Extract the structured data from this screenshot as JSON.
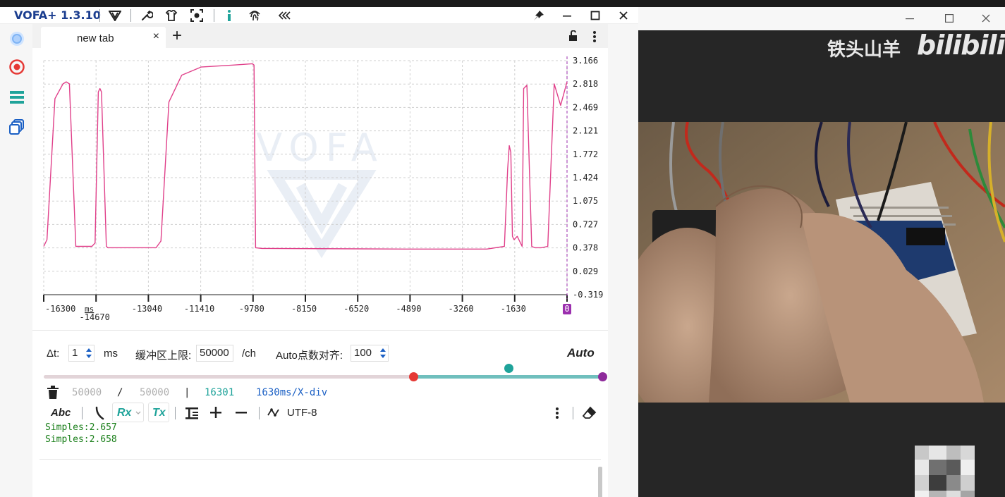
{
  "app": {
    "title": "VOFA+ 1.3.10",
    "colors": {
      "accent": "#1a3d8f",
      "teal": "#1fa39a",
      "trace": "#e0408a",
      "cursor": "#9b2fae",
      "red": "#e53935"
    }
  },
  "titlebar": {
    "icons": [
      "vofa-logo-icon",
      "wrench-icon",
      "shirt-icon",
      "focus-icon",
      "info-icon",
      "fingerprint-icon",
      "collapse-icon"
    ],
    "window_controls": [
      "pin-icon",
      "minimize-icon",
      "maximize-icon",
      "close-icon"
    ]
  },
  "sidebar": {
    "items": [
      "connect-icon",
      "record-icon",
      "menu-icon",
      "layers-icon"
    ]
  },
  "tabs": {
    "items": [
      {
        "label": "new tab",
        "close": "×"
      }
    ],
    "add": "+",
    "lock_icon": "lock-icon",
    "more_icon": "more-vert-icon"
  },
  "plot": {
    "y_ticks": [
      "3.166",
      "2.818",
      "2.469",
      "2.121",
      "1.772",
      "1.424",
      "1.075",
      "0.727",
      "0.378",
      "0.029",
      "-0.319"
    ],
    "x_ticks": [
      "-16300",
      "-14670",
      "-13040",
      "-11410",
      "-9780",
      "-8150",
      "-6520",
      "-4890",
      "-3260",
      "-1630",
      "0"
    ],
    "x_unit": "ms",
    "watermark": "VOFA"
  },
  "chart_data": {
    "type": "line",
    "x": [
      -16300,
      -16200,
      -15950,
      -15700,
      -15600,
      -15500,
      -15300,
      -14800,
      -14700,
      -14600,
      -14550,
      -14500,
      -14350,
      -14300,
      -12800,
      -12650,
      -12400,
      -12000,
      -11400,
      -10400,
      -9800,
      -9750,
      -9700,
      -9500,
      -5000,
      -2500,
      -1950,
      -1850,
      -1800,
      -1750,
      -1700,
      -1650,
      -1550,
      -1400,
      -1350,
      -1250,
      -1100,
      -1000,
      -800,
      -600,
      -400,
      -200,
      0
    ],
    "y": [
      0.4,
      0.5,
      2.6,
      2.82,
      2.85,
      2.82,
      0.4,
      0.4,
      0.45,
      2.7,
      2.75,
      2.7,
      0.4,
      0.38,
      0.38,
      0.48,
      2.55,
      2.95,
      3.07,
      3.1,
      3.12,
      3.1,
      0.38,
      0.37,
      0.36,
      0.36,
      0.4,
      1.55,
      1.9,
      1.8,
      0.55,
      0.5,
      0.55,
      0.4,
      2.75,
      2.8,
      0.4,
      0.38,
      0.38,
      0.4,
      2.82,
      2.5,
      2.85
    ],
    "series": [
      {
        "name": "",
        "color": "#e0408a"
      }
    ],
    "ylim": [
      -0.319,
      3.166
    ],
    "xlim": [
      -16300,
      0
    ],
    "xlabel": "ms",
    "ylabel": "",
    "grid": true
  },
  "controls": {
    "dt_label": "Δt:",
    "dt_value": "1",
    "dt_unit": "ms",
    "buffer_label": "缓冲区上限:",
    "buffer_value": "50000",
    "buffer_unit": "/ch",
    "auto_align_label": "Auto点数对齐:",
    "auto_align_value": "100",
    "auto_button": "Auto",
    "slider_position": 0.66
  },
  "stats": {
    "buffered": "50000",
    "slash": "/",
    "total": "50000",
    "bar": "|",
    "count": "16301",
    "scale": "1630ms/X-div"
  },
  "toolbar2": {
    "abc": "Abc",
    "rx": "Rx",
    "tx": "Tx",
    "encoding": "UTF-8"
  },
  "log": {
    "lines": [
      "Simples:2.657",
      "Simples:2.658"
    ]
  },
  "browser": {
    "watermark_cn": "铁头山羊",
    "watermark_logo": "bilibili",
    "controls": [
      "minimize-icon",
      "maximize-icon",
      "close-icon"
    ]
  }
}
